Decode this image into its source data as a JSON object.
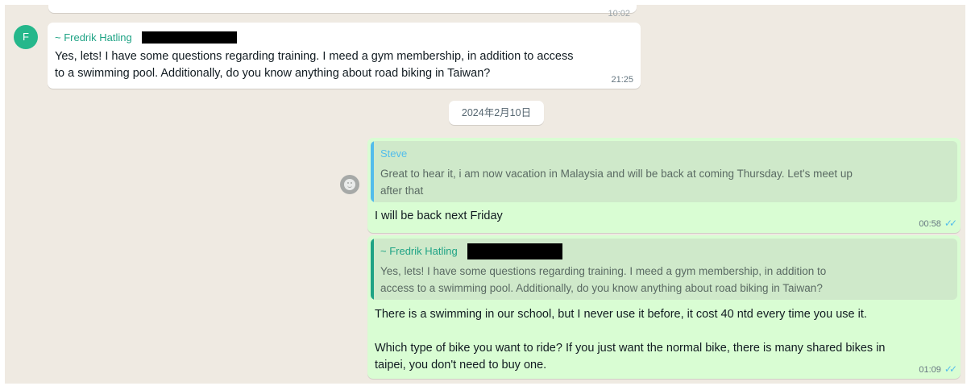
{
  "conversation": {
    "top_partial_time": "10:02",
    "avatar_initial": "F",
    "msg1": {
      "sender": "~ Fredrik Hatling",
      "text_line1": "Yes, lets! I have some questions regarding training. I meed a gym membership, in addition to access",
      "text_line2": "to a swimming pool. Additionally, do you know anything about road biking in Taiwan?",
      "time": "21:25"
    },
    "date_divider": "2024年2月10日",
    "msg2": {
      "quote_sender": "Steve",
      "quote_text_line1": "Great to hear it, i am now vacation in Malaysia and will be back at coming Thursday. Let's meet up",
      "quote_text_line2": "after that",
      "text": "I will be back next Friday",
      "time": "00:58",
      "ticks": "✓✓"
    },
    "msg3": {
      "quote_sender": "~ Fredrik Hatling",
      "quote_text_line1": "Yes, lets! I have some questions regarding training. I meed a gym membership, in addition to",
      "quote_text_line2": "access to a swimming pool. Additionally, do you know anything about road biking in Taiwan?",
      "text_line1": "There is a swimming in our school, but I never use it before, it cost 40 ntd every time you use it.",
      "text_line2": "Which type of bike you want to ride? If you just want the normal bike, there is many shared bikes in",
      "text_line3": "taipei, you don't need to buy one.",
      "time": "01:09",
      "ticks": "✓✓"
    }
  },
  "colors": {
    "chat_background": "#efeae2",
    "outgoing_bubble": "#d9fdd3",
    "incoming_bubble": "#ffffff",
    "sender_green": "#1fa385",
    "quote_blue": "#53bdeb",
    "read_ticks": "#53bdeb"
  },
  "icons": {
    "emoji_reaction": "smiley-icon",
    "read_receipt": "double-check-icon"
  }
}
